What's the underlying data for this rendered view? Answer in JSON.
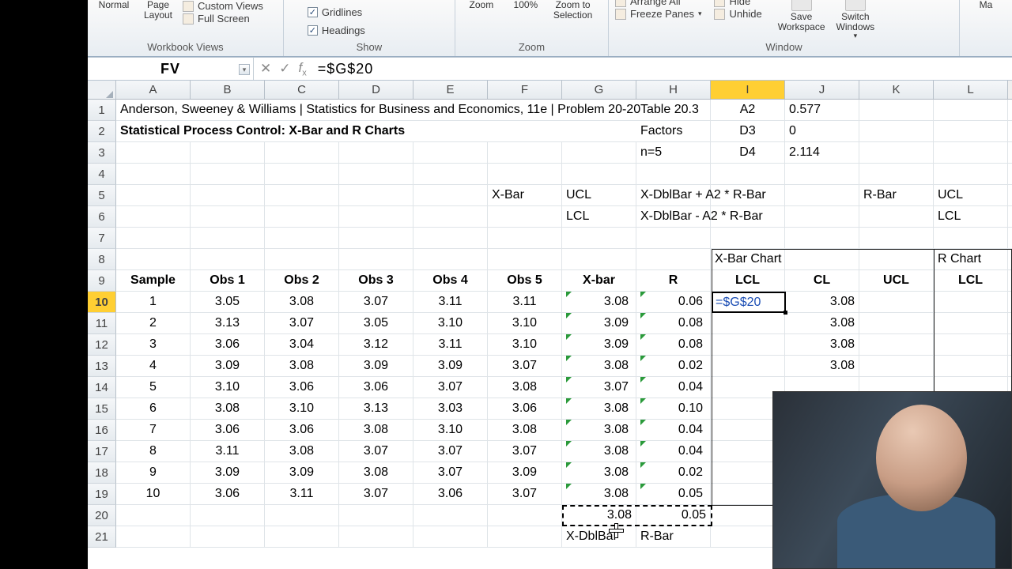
{
  "ribbon": {
    "views": {
      "normal": "Normal",
      "page_layout": "Page\nLayout",
      "custom_views": "Custom Views",
      "full_screen": "Full Screen",
      "group": "Workbook Views"
    },
    "show": {
      "gridlines": "Gridlines",
      "headings": "Headings",
      "group": "Show"
    },
    "zoom": {
      "zoom": "Zoom",
      "pct": "100%",
      "to_sel": "Zoom to\nSelection",
      "group": "Zoom"
    },
    "window": {
      "arrange": "Arrange All",
      "freeze": "Freeze Panes",
      "hide": "Hide",
      "unhide": "Unhide",
      "save_ws": "Save\nWorkspace",
      "switch": "Switch\nWindows",
      "group": "Window"
    },
    "macros": "Ma"
  },
  "namebox": "FV",
  "formula": "=$G$20",
  "cols": [
    "A",
    "B",
    "C",
    "D",
    "E",
    "F",
    "G",
    "H",
    "I",
    "J",
    "K",
    "L"
  ],
  "rows": [
    "1",
    "2",
    "3",
    "4",
    "5",
    "6",
    "7",
    "8",
    "9",
    "10",
    "11",
    "12",
    "13",
    "14",
    "15",
    "16",
    "17",
    "18",
    "19",
    "20",
    "21"
  ],
  "r1": {
    "A": "Anderson, Sweeney & Williams | Statistics for Business and Economics, 11e | Problem 20-20",
    "H": "Table 20.3",
    "I": "A2",
    "J": "0.577"
  },
  "r2": {
    "A": "Statistical Process Control:  X-Bar and R Charts",
    "H": "Factors",
    "I": "D3",
    "J": "0"
  },
  "r3": {
    "H": "n=5",
    "I": "D4",
    "J": "2.114"
  },
  "r5": {
    "F": "X-Bar",
    "G": "UCL",
    "H": "X-DblBar + A2 * R-Bar",
    "K": "R-Bar",
    "L": "UCL"
  },
  "r6": {
    "G": "LCL",
    "H": "X-DblBar - A2 * R-Bar",
    "L": "LCL"
  },
  "r8": {
    "I": "X-Bar Chart",
    "L": "R Chart"
  },
  "r9": {
    "A": "Sample",
    "B": "Obs 1",
    "C": "Obs 2",
    "D": "Obs 3",
    "E": "Obs 4",
    "F": "Obs 5",
    "G": "X-bar",
    "H": "R",
    "I": "LCL",
    "J": "CL",
    "K": "UCL",
    "L": "LCL"
  },
  "tbl": [
    {
      "s": "1",
      "o": [
        "3.05",
        "3.08",
        "3.07",
        "3.11",
        "3.11"
      ],
      "xb": "3.08",
      "r": "0.06",
      "lcl": "=$G$20",
      "cl": "3.08"
    },
    {
      "s": "2",
      "o": [
        "3.13",
        "3.07",
        "3.05",
        "3.10",
        "3.10"
      ],
      "xb": "3.09",
      "r": "0.08",
      "cl": "3.08"
    },
    {
      "s": "3",
      "o": [
        "3.06",
        "3.04",
        "3.12",
        "3.11",
        "3.10"
      ],
      "xb": "3.09",
      "r": "0.08",
      "cl": "3.08"
    },
    {
      "s": "4",
      "o": [
        "3.09",
        "3.08",
        "3.09",
        "3.09",
        "3.07"
      ],
      "xb": "3.08",
      "r": "0.02",
      "cl": "3.08"
    },
    {
      "s": "5",
      "o": [
        "3.10",
        "3.06",
        "3.06",
        "3.07",
        "3.08"
      ],
      "xb": "3.07",
      "r": "0.04"
    },
    {
      "s": "6",
      "o": [
        "3.08",
        "3.10",
        "3.13",
        "3.03",
        "3.06"
      ],
      "xb": "3.08",
      "r": "0.10"
    },
    {
      "s": "7",
      "o": [
        "3.06",
        "3.06",
        "3.08",
        "3.10",
        "3.08"
      ],
      "xb": "3.08",
      "r": "0.04"
    },
    {
      "s": "8",
      "o": [
        "3.11",
        "3.08",
        "3.07",
        "3.07",
        "3.07"
      ],
      "xb": "3.08",
      "r": "0.04"
    },
    {
      "s": "9",
      "o": [
        "3.09",
        "3.09",
        "3.08",
        "3.07",
        "3.09"
      ],
      "xb": "3.08",
      "r": "0.02"
    },
    {
      "s": "10",
      "o": [
        "3.06",
        "3.11",
        "3.07",
        "3.06",
        "3.07"
      ],
      "xb": "3.08",
      "r": "0.05"
    }
  ],
  "r20": {
    "G": "3.08",
    "H": "0.05"
  },
  "r21": {
    "G": "X-DblBar",
    "H": "R-Bar"
  },
  "sel_col": "I",
  "sel_row": "10"
}
